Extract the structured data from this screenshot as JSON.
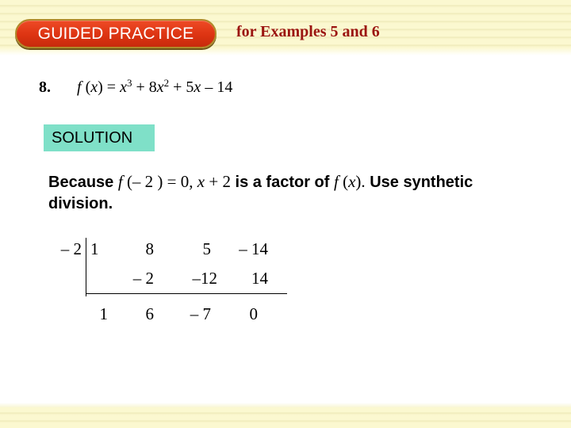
{
  "header": {
    "badge_label": "GUIDED PRACTICE",
    "examples_label": "for Examples 5 and 6",
    "colors": {
      "badge_fill": "#dd3412",
      "badge_border": "#b08a2a",
      "examples_text": "#9b1410",
      "band": "#fbf8d0"
    }
  },
  "problem": {
    "number": "8.",
    "function_name": "f",
    "open_paren": " (",
    "variable": "x",
    "close_paren": ")",
    "equals": " = ",
    "term1_var": "x",
    "term1_exp": "3",
    "plus1": " + 8",
    "term2_var": "x",
    "term2_exp": "2",
    "plus2": " + 5",
    "term3_var": "x",
    "constant": " – 14"
  },
  "solution": {
    "label": "SOLUTION",
    "color": "#7fe0c8"
  },
  "explanation": {
    "part1": "Because ",
    "f1": "f",
    "math1": " (– 2 ) = 0, ",
    "x1": "x",
    "math2": " + 2",
    "part2": " is a factor of ",
    "f2": "f",
    "math3": " (",
    "x2": "x",
    "math4": ").",
    "part3": " Use synthetic division."
  },
  "synthetic_division": {
    "divisor": "– 2",
    "coefficients": [
      "1",
      "8",
      "5",
      "– 14"
    ],
    "products": [
      "– 2",
      "–12",
      "14"
    ],
    "results": [
      "1",
      "6",
      "– 7",
      "0"
    ]
  }
}
